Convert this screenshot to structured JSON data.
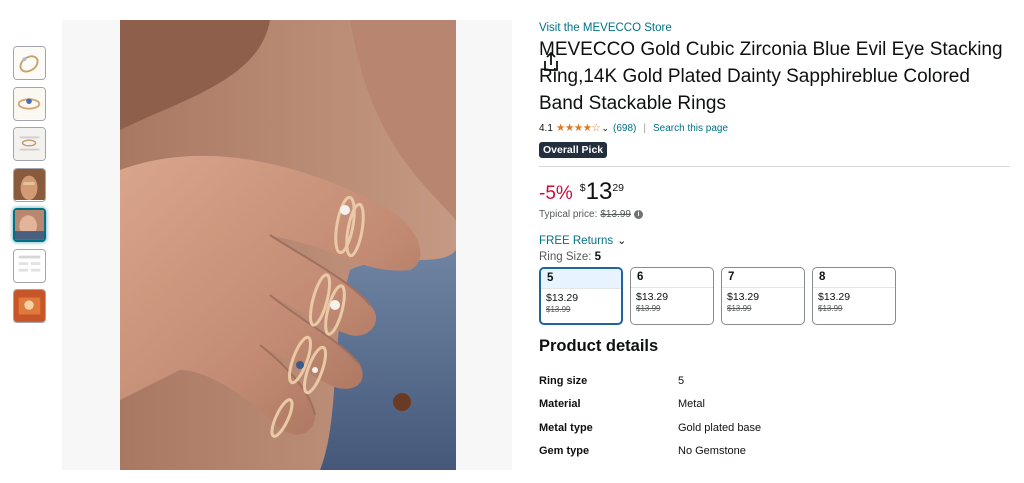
{
  "store": {
    "link_text": "Visit the MEVECCO Store"
  },
  "product": {
    "title": "MEVECCO Gold Cubic Zirconia Blue Evil Eye Stacking Ring,14K Gold Plated Dainty Sapphireblue Colored Band Stackable Rings",
    "rating": "4.1",
    "stars": "★★★★☆",
    "review_count": "(698)",
    "search_link": "Search this page",
    "badge": "Overall Pick"
  },
  "price": {
    "discount": "-5%",
    "currency": "$",
    "whole": "13",
    "fraction": "29",
    "typical_label": "Typical price:",
    "typical_value": "$13.99"
  },
  "returns": {
    "label": "FREE Returns"
  },
  "ring_size": {
    "label": "Ring Size:",
    "selected": "5",
    "options": [
      {
        "size": "5",
        "price": "$13.29",
        "was": "$13.99"
      },
      {
        "size": "6",
        "price": "$13.29",
        "was": "$13.99"
      },
      {
        "size": "7",
        "price": "$13.29",
        "was": "$13.99"
      },
      {
        "size": "8",
        "price": "$13.29",
        "was": "$13.99"
      }
    ]
  },
  "details": {
    "title": "Product details",
    "rows": [
      {
        "key": "Ring size",
        "value": "5"
      },
      {
        "key": "Material",
        "value": "Metal"
      },
      {
        "key": "Metal type",
        "value": "Gold plated base"
      },
      {
        "key": "Gem type",
        "value": "No Gemstone"
      }
    ]
  },
  "icons": {
    "share": "share-icon",
    "chevron": "chevron-down-icon",
    "info": "info-icon"
  },
  "colors": {
    "link": "#007185",
    "deal": "#cc0c39",
    "star": "#de7921",
    "badge": "#232f3e",
    "selected_border": "#2162a1"
  }
}
